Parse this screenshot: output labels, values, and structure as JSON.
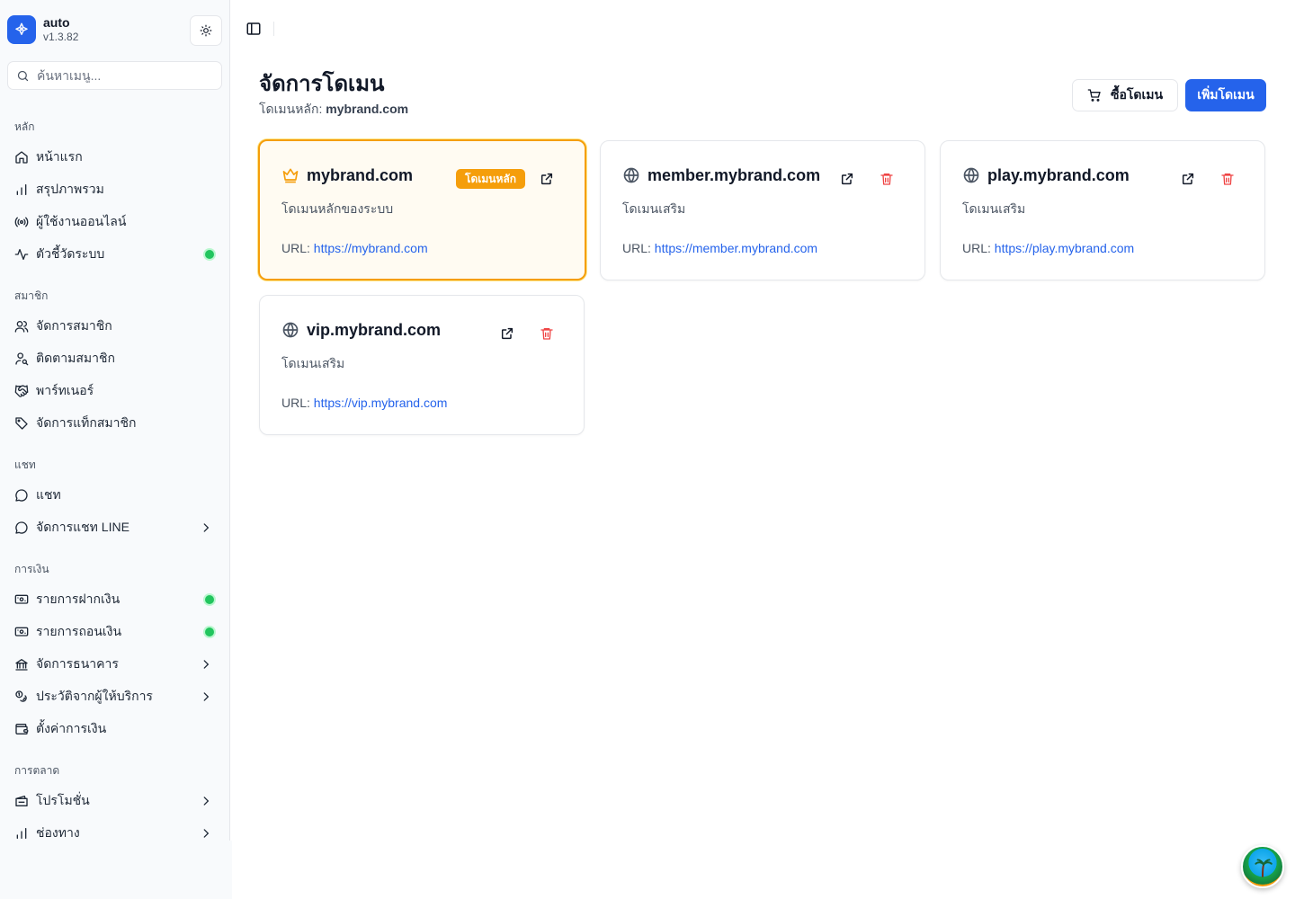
{
  "app": {
    "name": "auto",
    "version": "v1.3.82"
  },
  "search": {
    "placeholder": "ค้นหาเมนู..."
  },
  "sidebar": {
    "groups": [
      {
        "label": "หลัก",
        "items": [
          {
            "label": "หน้าแรก",
            "icon": "home-icon"
          },
          {
            "label": "สรุปภาพรวม",
            "icon": "bar-chart-icon"
          },
          {
            "label": "ผู้ใช้งานออนไลน์",
            "icon": "broadcast-icon"
          },
          {
            "label": "ตัวชี้วัดระบบ",
            "icon": "activity-icon",
            "status_dot": true
          }
        ]
      },
      {
        "label": "สมาชิก",
        "items": [
          {
            "label": "จัดการสมาชิก",
            "icon": "users-icon"
          },
          {
            "label": "ติดตามสมาชิก",
            "icon": "user-search-icon"
          },
          {
            "label": "พาร์ทเนอร์",
            "icon": "handshake-icon"
          },
          {
            "label": "จัดการแท็กสมาชิก",
            "icon": "tag-icon"
          }
        ]
      },
      {
        "label": "แชท",
        "items": [
          {
            "label": "แชท",
            "icon": "chat-icon"
          },
          {
            "label": "จัดการแชท LINE",
            "icon": "chat-icon",
            "has_submenu": true
          }
        ]
      },
      {
        "label": "การเงิน",
        "items": [
          {
            "label": "รายการฝากเงิน",
            "icon": "deposit-icon",
            "status_dot": true
          },
          {
            "label": "รายการถอนเงิน",
            "icon": "withdraw-icon",
            "status_dot": true
          },
          {
            "label": "จัดการธนาคาร",
            "icon": "bank-icon",
            "has_submenu": true
          },
          {
            "label": "ประวัติจากผู้ให้บริการ",
            "icon": "coins-icon",
            "has_submenu": true
          },
          {
            "label": "ตั้งค่าการเงิน",
            "icon": "wallet-icon"
          }
        ]
      },
      {
        "label": "การตลาด",
        "items": [
          {
            "label": "โปรโมชั่น",
            "icon": "ticket-icon",
            "has_submenu": true
          },
          {
            "label": "ช่องทาง",
            "icon": "bar-chart-icon",
            "has_submenu": true
          }
        ]
      }
    ]
  },
  "page": {
    "title": "จัดการโดเมน",
    "subtitle_prefix": "โดเมนหลัก:",
    "subtitle_domain": "mybrand.com",
    "buy_button": "ซื้อโดเมน",
    "add_button": "เพิ่มโดเมน"
  },
  "domains": [
    {
      "name": "mybrand.com",
      "description": "โดเมนหลักของระบบ",
      "url_label": "URL:",
      "url": "https://mybrand.com",
      "primary": true,
      "badge": "โดเมนหลัก"
    },
    {
      "name": "member.mybrand.com",
      "description": "โดเมนเสริม",
      "url_label": "URL:",
      "url": "https://member.mybrand.com",
      "primary": false
    },
    {
      "name": "play.mybrand.com",
      "description": "โดเมนเสริม",
      "url_label": "URL:",
      "url": "https://play.mybrand.com",
      "primary": false
    },
    {
      "name": "vip.mybrand.com",
      "description": "โดเมนเสริม",
      "url_label": "URL:",
      "url": "https://vip.mybrand.com",
      "primary": false
    }
  ],
  "colors": {
    "accent": "#2563eb",
    "primary_domain": "#f59e0b",
    "danger": "#ef4444",
    "online": "#22c55e"
  }
}
